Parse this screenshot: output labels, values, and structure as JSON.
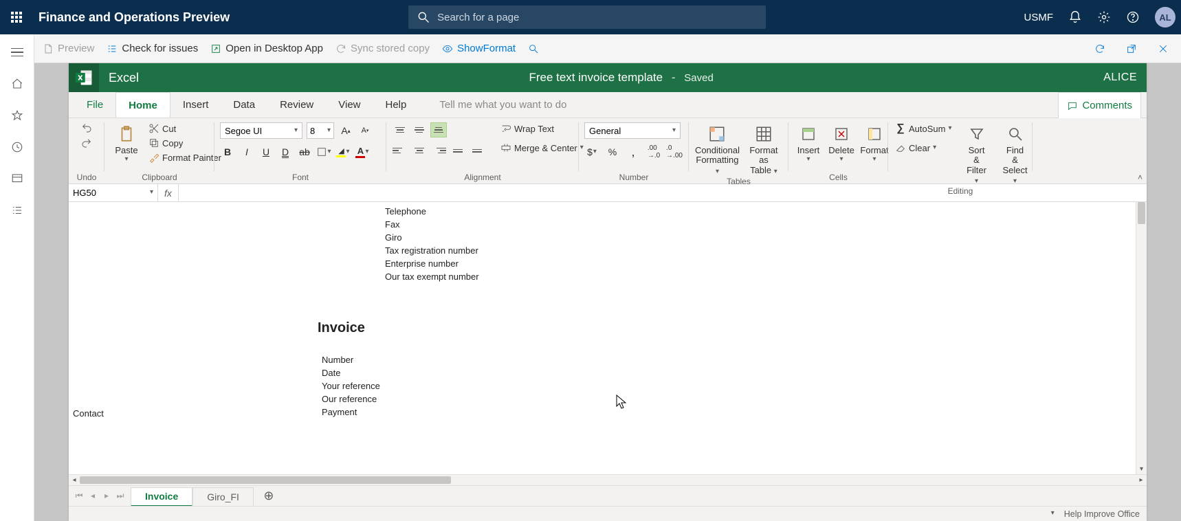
{
  "topnav": {
    "title": "Finance and Operations Preview",
    "search_placeholder": "Search for a page",
    "entity": "USMF",
    "avatar": "AL"
  },
  "sectoolbar": {
    "preview": "Preview",
    "check": "Check for issues",
    "openDesktop": "Open in Desktop App",
    "sync": "Sync stored copy",
    "showFormat": "ShowFormat"
  },
  "excel": {
    "appname": "Excel",
    "docname": "Free text invoice template",
    "dash": "-",
    "saved": "Saved",
    "user": "ALICE"
  },
  "tabs": {
    "file": "File",
    "home": "Home",
    "insert": "Insert",
    "data": "Data",
    "review": "Review",
    "view": "View",
    "help": "Help",
    "tellme": "Tell me what you want to do",
    "comments": "Comments"
  },
  "ribbon": {
    "undo": "Undo",
    "paste": "Paste",
    "cut": "Cut",
    "copy": "Copy",
    "formatPainter": "Format Painter",
    "clipboard": "Clipboard",
    "fontName": "Segoe UI",
    "fontSize": "8",
    "font": "Font",
    "wrap": "Wrap Text",
    "merge": "Merge & Center",
    "alignment": "Alignment",
    "numfmt": "General",
    "number": "Number",
    "condFmt1": "Conditional",
    "condFmt2": "Formatting",
    "asTable1": "Format",
    "asTable2": "as Table",
    "tables": "Tables",
    "insertc": "Insert",
    "deletec": "Delete",
    "formatc": "Format",
    "cells": "Cells",
    "autosum": "AutoSum",
    "clear": "Clear",
    "sort1": "Sort &",
    "sort2": "Filter",
    "find1": "Find &",
    "find2": "Select",
    "editing": "Editing"
  },
  "namebox": "HG50",
  "sheet": {
    "telephone": "Telephone",
    "fax": "Fax",
    "giro": "Giro",
    "taxreg": "Tax registration number",
    "enterprise": "Enterprise number",
    "taxexempt": "Our tax exempt number",
    "invoice": "Invoice",
    "number": "Number",
    "date": "Date",
    "yourref": "Your reference",
    "ourref": "Our reference",
    "payment": "Payment",
    "contact": "Contact"
  },
  "sheettabs": {
    "invoice": "Invoice",
    "giro": "Giro_FI"
  },
  "status": {
    "help": "Help Improve Office"
  }
}
